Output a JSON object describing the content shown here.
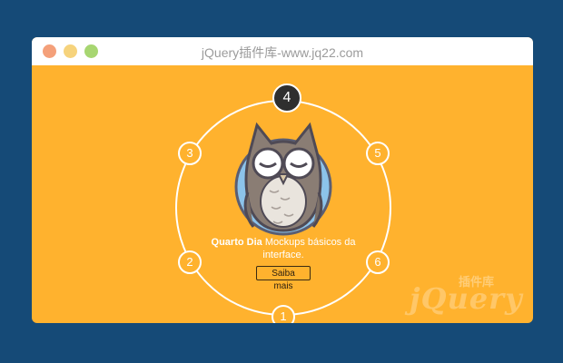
{
  "window": {
    "title": "jQuery插件库-www.jq22.com"
  },
  "carousel": {
    "active_step": "4",
    "steps": [
      "1",
      "2",
      "3",
      "4",
      "5",
      "6"
    ],
    "caption": {
      "bold": "Quarto Dia",
      "text": "Mockups básicos da interface."
    },
    "button_label": "Saiba mais"
  },
  "watermark": {
    "word": "jQuery",
    "cn": "插件库"
  },
  "colors": {
    "background": "#154a77",
    "accent": "#ffb22e",
    "active_node": "#2f2f2f"
  }
}
